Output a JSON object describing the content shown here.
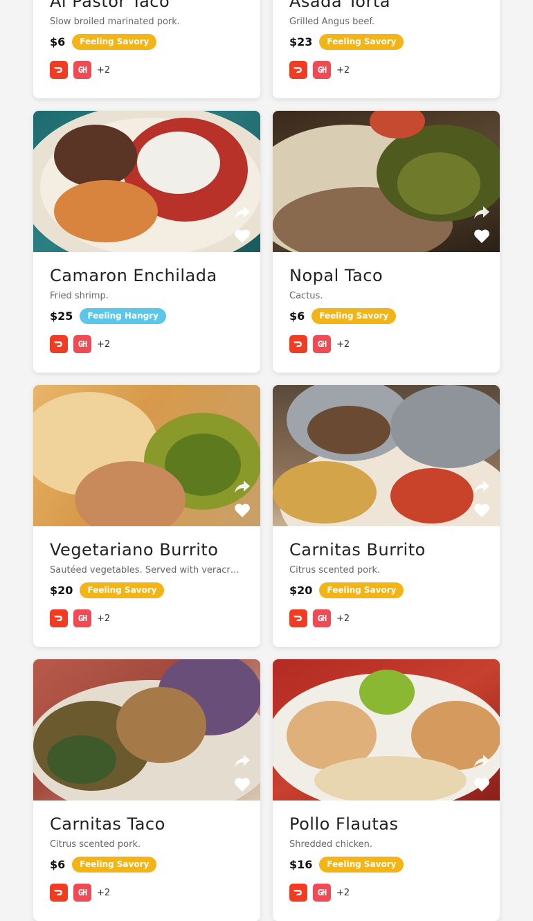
{
  "colors": {
    "savory_badge": "#f2b416",
    "hangry_badge": "#5cc6ea",
    "doordash": "#ef3c23",
    "grubhub": "#f04b55"
  },
  "icons": {
    "share": "share-icon",
    "favorite": "heart-icon",
    "doordash": "doordash-icon",
    "grubhub": "grubhub-icon"
  },
  "items": [
    {
      "title": "Al Pastor Taco",
      "description": "Slow broiled marinated pork.",
      "price": "$6",
      "badge": "Feeling Savory",
      "badge_type": "savory",
      "grubhub_label": "GH",
      "more": "+2"
    },
    {
      "title": "Asada Torta",
      "description": "Grilled Angus beef.",
      "price": "$23",
      "badge": "Feeling Savory",
      "badge_type": "savory",
      "grubhub_label": "GH",
      "more": "+2"
    },
    {
      "title": "Camaron Enchilada",
      "description": "Fried shrimp.",
      "price": "$25",
      "badge": "Feeling Hangry",
      "badge_type": "hangry",
      "grubhub_label": "GH",
      "more": "+2"
    },
    {
      "title": "Nopal Taco",
      "description": "Cactus.",
      "price": "$6",
      "badge": "Feeling Savory",
      "badge_type": "savory",
      "grubhub_label": "GH",
      "more": "+2"
    },
    {
      "title": "Vegetariano Burrito",
      "description": "Sautéed vegetables. Served with veracru…",
      "price": "$20",
      "badge": "Feeling Savory",
      "badge_type": "savory",
      "grubhub_label": "GH",
      "more": "+2"
    },
    {
      "title": "Carnitas Burrito",
      "description": "Citrus scented pork.",
      "price": "$20",
      "badge": "Feeling Savory",
      "badge_type": "savory",
      "grubhub_label": "GH",
      "more": "+2"
    },
    {
      "title": "Carnitas Taco",
      "description": "Citrus scented pork.",
      "price": "$6",
      "badge": "Feeling Savory",
      "badge_type": "savory",
      "grubhub_label": "GH",
      "more": "+2"
    },
    {
      "title": "Pollo Flautas",
      "description": "Shredded chicken.",
      "price": "$16",
      "badge": "Feeling Savory",
      "badge_type": "savory",
      "grubhub_label": "GH",
      "more": "+2"
    }
  ]
}
